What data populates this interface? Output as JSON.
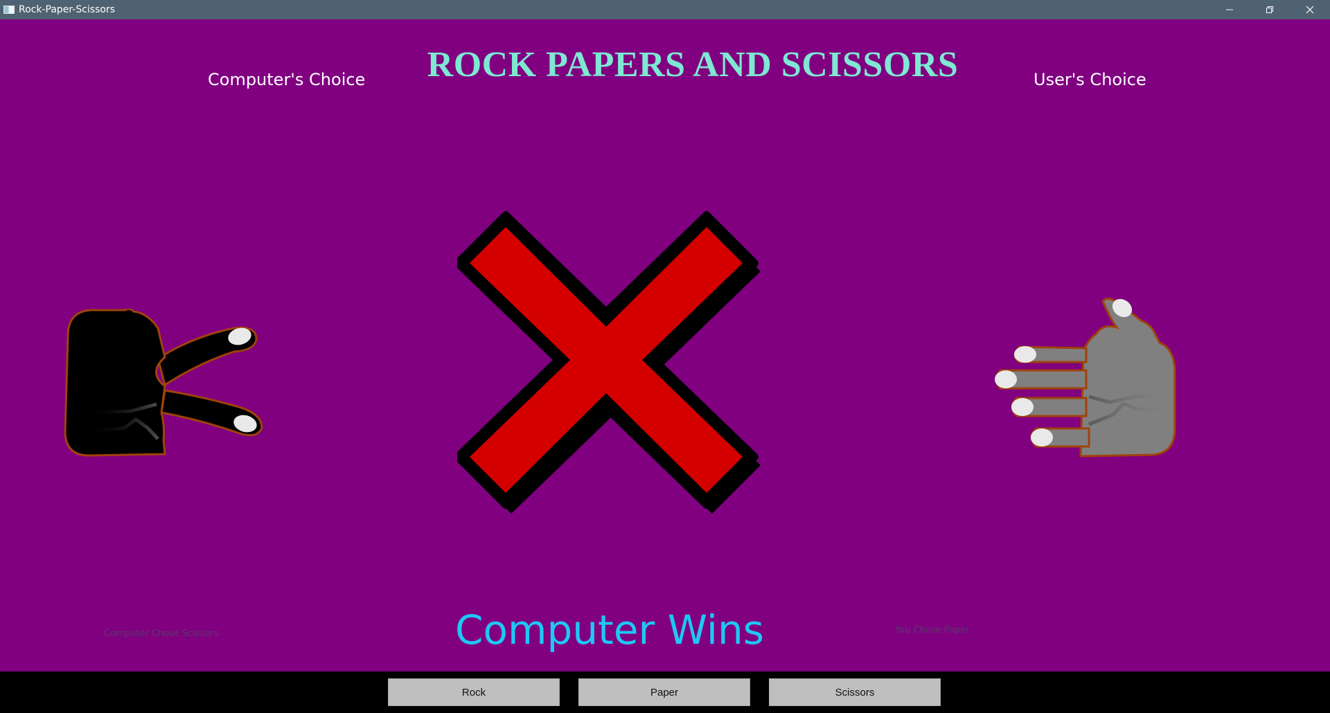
{
  "window": {
    "title": "Rock-Paper-Scissors",
    "app_icon": "window-app-icon",
    "controls": [
      "minimize-icon",
      "restore-icon",
      "close-icon"
    ]
  },
  "game": {
    "title": "ROCK PAPERS AND SCISSORS",
    "computer_heading": "Computer's Choice",
    "user_heading": "User's Choice",
    "computer_choice_icon": "scissors-hand-icon",
    "user_choice_icon": "paper-hand-icon",
    "result_icon": "red-x-icon",
    "result_text": "Computer Wins",
    "computer_status": "Computer Chose Scissors",
    "user_status": "You Chose Paper"
  },
  "buttons": {
    "rock": "Rock",
    "paper": "Paper",
    "scissors": "Scissors"
  },
  "colors": {
    "background": "#800080",
    "title": "#7ee8d2",
    "result": "#1ec8f5",
    "x_mark": "#d40000",
    "titlebar": "#4f6272"
  }
}
